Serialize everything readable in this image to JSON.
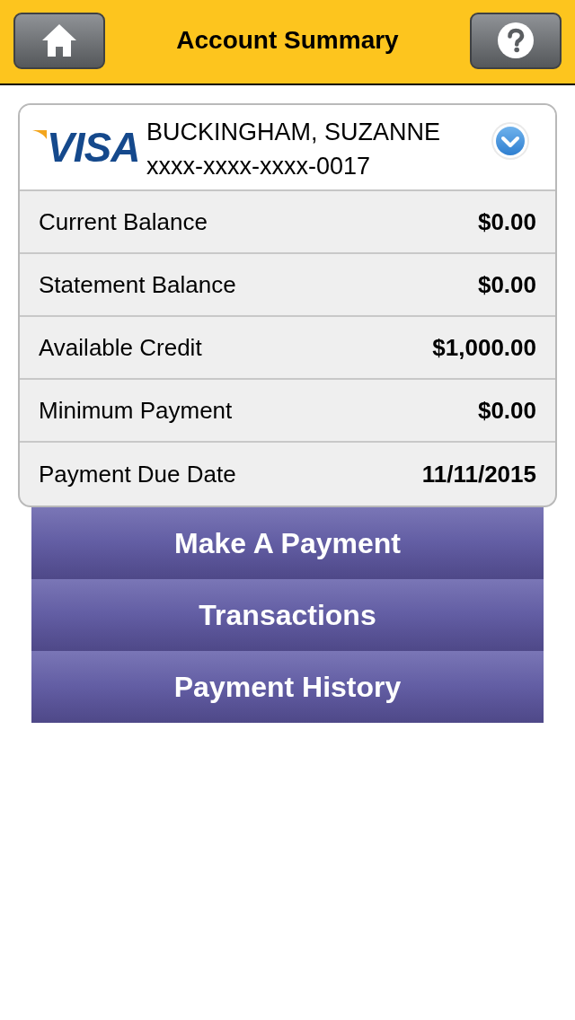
{
  "header": {
    "title": "Account Summary"
  },
  "card": {
    "brand": "VISA",
    "holder": "BUCKINGHAM, SUZANNE",
    "number": "xxxx-xxxx-xxxx-0017"
  },
  "details": [
    {
      "label": "Current Balance",
      "value": "$0.00"
    },
    {
      "label": "Statement Balance",
      "value": "$0.00"
    },
    {
      "label": "Available Credit",
      "value": "$1,000.00"
    },
    {
      "label": "Minimum Payment",
      "value": "$0.00"
    },
    {
      "label": "Payment Due Date",
      "value": "11/11/2015"
    }
  ],
  "actions": [
    "Make A Payment",
    "Transactions",
    "Payment History"
  ]
}
